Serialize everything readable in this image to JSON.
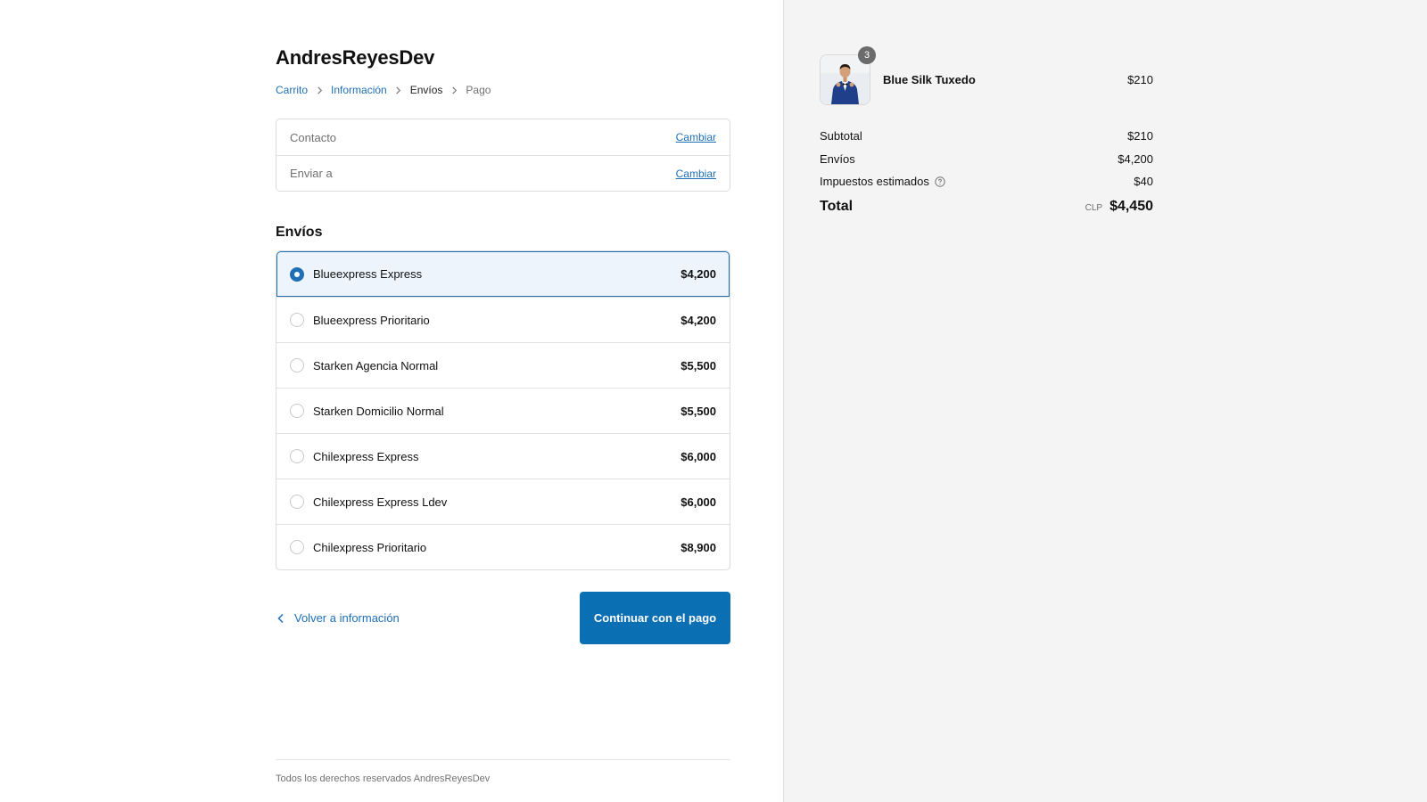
{
  "store": {
    "title": "AndresReyesDev"
  },
  "breadcrumb": [
    {
      "label": "Carrito"
    },
    {
      "label": "Información"
    },
    {
      "label": "Envíos"
    },
    {
      "label": "Pago"
    }
  ],
  "review": {
    "contact_label": "Contacto",
    "shipto_label": "Enviar a",
    "change_label": "Cambiar"
  },
  "shipping": {
    "title": "Envíos",
    "options": [
      {
        "name": "Blueexpress Express",
        "price": "$4,200",
        "selected": true
      },
      {
        "name": "Blueexpress Prioritario",
        "price": "$4,200",
        "selected": false
      },
      {
        "name": "Starken Agencia Normal",
        "price": "$5,500",
        "selected": false
      },
      {
        "name": "Starken Domicilio Normal",
        "price": "$5,500",
        "selected": false
      },
      {
        "name": "Chilexpress Express",
        "price": "$6,000",
        "selected": false
      },
      {
        "name": "Chilexpress Express Ldev",
        "price": "$6,000",
        "selected": false
      },
      {
        "name": "Chilexpress Prioritario",
        "price": "$8,900",
        "selected": false
      }
    ]
  },
  "actions": {
    "back_label": "Volver a información",
    "continue_label": "Continuar con el pago"
  },
  "footer": {
    "text": "Todos los derechos reservados AndresReyesDev"
  },
  "summary": {
    "product": {
      "name": "Blue Silk Tuxedo",
      "price": "$210",
      "quantity": "3",
      "image": "person-in-blue-tuxedo"
    },
    "subtotal_label": "Subtotal",
    "subtotal_value": "$210",
    "shipping_label": "Envíos",
    "shipping_value": "$4,200",
    "taxes_label": "Impuestos estimados",
    "taxes_value": "$40",
    "total_label": "Total",
    "currency": "CLP",
    "total_value": "$4,450"
  },
  "colors": {
    "accent": "#1f6fb5",
    "button": "#0a6fb3",
    "selected_bg": "#eef4fb",
    "sidebar_bg": "#f4f4f4"
  }
}
